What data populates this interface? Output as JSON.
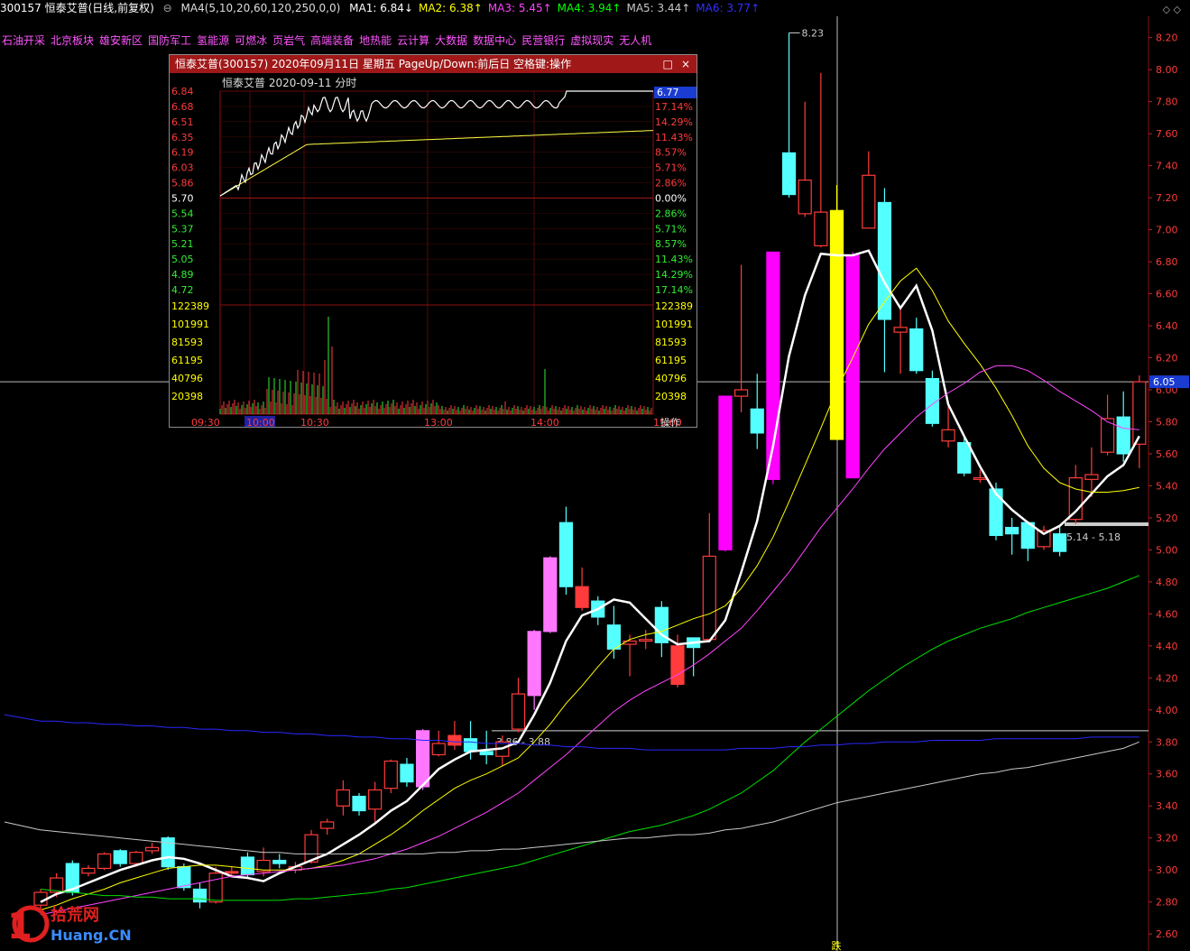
{
  "header": {
    "stock": "300157 恒泰艾普(日线,前复权)",
    "ma_label": "MA4(5,10,20,60,120,250,0,0)",
    "ma": [
      {
        "text": "MA1: 6.84↓",
        "color": "#ffffff"
      },
      {
        "text": "MA2: 6.38↑",
        "color": "#ffff00"
      },
      {
        "text": "MA3: 5.45↑",
        "color": "#ff44ff"
      },
      {
        "text": "MA4: 3.94↑",
        "color": "#00ff00"
      },
      {
        "text": "MA5: 3.44↑",
        "color": "#c8c8c8"
      },
      {
        "text": "MA6: 3.77↑",
        "color": "#3030ff"
      }
    ],
    "win_ctrl": "◇ ◇"
  },
  "tags": [
    "石油开采",
    "北京板块",
    "雄安新区",
    "国防军工",
    "氢能源",
    "可燃冰",
    "页岩气",
    "高端装备",
    "地热能",
    "云计算",
    "大数据",
    "数据中心",
    "民营银行",
    "虚拟现实",
    "无人机"
  ],
  "popup": {
    "title": "恒泰艾普(300157) 2020年09月11日 星期五 PageUp/Down:前后日 空格键:操作",
    "subtitle": "恒泰艾普   2020-09-11 分时",
    "price_labels": [
      "6.84",
      "6.68",
      "6.51",
      "6.35",
      "6.19",
      "6.03",
      "5.86",
      "5.70",
      "5.54",
      "5.37",
      "5.21",
      "5.05",
      "4.89",
      "4.72"
    ],
    "pct_labels": [
      "17.14%",
      "14.29%",
      "11.43%",
      "8.57%",
      "5.71%",
      "2.86%",
      "0.00%",
      "2.86%",
      "5.71%",
      "8.57%",
      "11.43%",
      "14.29%",
      "17.14%"
    ],
    "vol_labels": [
      "122389",
      "101991",
      "81593",
      "61195",
      "40796",
      "20398"
    ],
    "time_labels": [
      "09:30",
      "10:00",
      "10:30",
      "13:00",
      "14:00",
      "15:00"
    ],
    "current": "6.77",
    "op_label": "操作",
    "close_icon": "×",
    "max_icon": "□"
  },
  "colors": {
    "up": "#ff3b3b",
    "down": "#54ffff",
    "grid": "#8a1010"
  },
  "chart_data": {
    "type": "candlestick",
    "ylim": [
      2.55,
      8.3
    ],
    "y_ticks": [
      "2.60",
      "2.80",
      "3.00",
      "3.20",
      "3.40",
      "3.60",
      "3.80",
      "4.00",
      "4.20",
      "4.40",
      "4.60",
      "4.80",
      "5.00",
      "5.20",
      "5.40",
      "5.60",
      "5.80",
      "6.00",
      "6.20",
      "6.40",
      "6.60",
      "6.80",
      "7.00",
      "7.20",
      "7.40",
      "7.60",
      "7.80",
      "8.00",
      "8.20"
    ],
    "candles": [
      [
        2.78,
        2.86,
        2.75,
        2.88,
        "#ff3b3b"
      ],
      [
        2.86,
        2.95,
        2.83,
        2.98,
        "#ff3b3b"
      ],
      [
        3.04,
        2.86,
        2.84,
        3.06,
        "#54ffff"
      ],
      [
        2.98,
        3.01,
        2.96,
        3.03,
        "#ff3b3b"
      ],
      [
        3.01,
        3.1,
        3.0,
        3.11,
        "#ff3b3b"
      ],
      [
        3.12,
        3.04,
        3.02,
        3.13,
        "#54ffff"
      ],
      [
        3.04,
        3.11,
        3.02,
        3.12,
        "#ff3b3b"
      ],
      [
        3.12,
        3.14,
        3.1,
        3.17,
        "#ff3b3b"
      ],
      [
        3.2,
        3.02,
        3.0,
        3.21,
        "#54ffff"
      ],
      [
        3.02,
        2.89,
        2.87,
        3.04,
        "#54ffff"
      ],
      [
        2.88,
        2.8,
        2.76,
        2.92,
        "#54ffff"
      ],
      [
        2.8,
        2.98,
        2.79,
        3.02,
        "#ff3b3b"
      ],
      [
        2.99,
        2.98,
        2.96,
        3.02,
        "#ff3b3b"
      ],
      [
        3.08,
        2.97,
        2.95,
        3.11,
        "#54ffff"
      ],
      [
        2.99,
        3.06,
        2.96,
        3.14,
        "#ff3b3b"
      ],
      [
        3.06,
        3.04,
        3.01,
        3.1,
        "#54ffff"
      ],
      [
        3.0,
        3.02,
        2.98,
        3.05,
        "#ff3b3b"
      ],
      [
        3.05,
        3.22,
        3.04,
        3.25,
        "#ff3b3b"
      ],
      [
        3.26,
        3.3,
        3.22,
        3.32,
        "#ff3b3b"
      ],
      [
        3.4,
        3.5,
        3.34,
        3.56,
        "#ff3b3b"
      ],
      [
        3.46,
        3.37,
        3.34,
        3.48,
        "#54ffff"
      ],
      [
        3.38,
        3.5,
        3.3,
        3.55,
        "#ff3b3b"
      ],
      [
        3.51,
        3.68,
        3.48,
        3.69,
        "#ff3b3b"
      ],
      [
        3.66,
        3.55,
        3.52,
        3.7,
        "#54ffff"
      ],
      [
        3.52,
        3.87,
        3.5,
        3.88,
        "#ff77ff"
      ],
      [
        3.72,
        3.79,
        3.71,
        3.87,
        "#ff3b3b"
      ],
      [
        3.84,
        3.78,
        3.75,
        3.93,
        "#ff3b3b"
      ],
      [
        3.82,
        3.74,
        3.69,
        3.93,
        "#54ffff"
      ],
      [
        3.74,
        3.72,
        3.66,
        3.87,
        "#54ffff"
      ],
      [
        3.71,
        3.8,
        3.65,
        3.84,
        "#ff3b3b"
      ],
      [
        3.88,
        4.1,
        3.86,
        4.2,
        "#ff3b3b"
      ],
      [
        4.09,
        4.49,
        4.0,
        4.5,
        "#ff77ff"
      ],
      [
        4.49,
        4.95,
        4.48,
        4.96,
        "#ff77ff"
      ],
      [
        5.17,
        4.77,
        4.72,
        5.27,
        "#54ffff"
      ],
      [
        4.77,
        4.64,
        4.62,
        4.89,
        "#ff3b3b"
      ],
      [
        4.68,
        4.58,
        4.53,
        4.71,
        "#54ffff"
      ],
      [
        4.53,
        4.38,
        4.32,
        4.65,
        "#54ffff"
      ],
      [
        4.41,
        4.43,
        4.21,
        4.47,
        "#ff3b3b"
      ],
      [
        4.43,
        4.44,
        4.38,
        4.5,
        "#ff3b3b"
      ],
      [
        4.64,
        4.42,
        4.33,
        4.68,
        "#54ffff"
      ],
      [
        4.4,
        4.16,
        4.14,
        4.47,
        "#ff3b3b"
      ],
      [
        4.45,
        4.39,
        4.21,
        4.44,
        "#54ffff"
      ],
      [
        4.44,
        4.96,
        4.43,
        5.23,
        "#ff3b3b"
      ],
      [
        5.0,
        5.96,
        4.99,
        5.96,
        "#ff00ff"
      ],
      [
        5.96,
        6.0,
        5.86,
        6.78,
        "#ff3b3b"
      ],
      [
        5.88,
        5.73,
        5.63,
        6.1,
        "#54ffff"
      ],
      [
        5.44,
        6.86,
        5.41,
        6.86,
        "#ff00ff"
      ],
      [
        7.48,
        7.22,
        7.2,
        8.23,
        "#54ffff"
      ],
      [
        7.1,
        7.31,
        7.08,
        7.8,
        "#ff3b3b"
      ],
      [
        6.9,
        7.11,
        6.89,
        7.98,
        "#ff3b3b"
      ],
      [
        7.12,
        5.69,
        5.7,
        7.28,
        "#ffff00"
      ],
      [
        6.84,
        5.45,
        5.47,
        6.86,
        "#ff00ff"
      ],
      [
        7.01,
        7.34,
        7.01,
        7.49,
        "#ff3b3b"
      ],
      [
        7.17,
        6.44,
        6.11,
        7.26,
        "#54ffff"
      ],
      [
        6.36,
        6.39,
        6.1,
        6.52,
        "#ff3b3b"
      ],
      [
        6.38,
        6.12,
        6.1,
        6.45,
        "#54ffff"
      ],
      [
        6.07,
        5.79,
        5.77,
        6.12,
        "#54ffff"
      ],
      [
        5.68,
        5.75,
        5.64,
        5.92,
        "#ff3b3b"
      ],
      [
        5.67,
        5.48,
        5.46,
        5.71,
        "#54ffff"
      ],
      [
        5.44,
        5.45,
        5.42,
        5.5,
        "#ff3b3b"
      ],
      [
        5.38,
        5.09,
        5.06,
        5.42,
        "#54ffff"
      ],
      [
        5.14,
        5.1,
        4.97,
        5.2,
        "#54ffff"
      ],
      [
        5.17,
        5.01,
        4.93,
        5.18,
        "#54ffff"
      ],
      [
        5.02,
        5.12,
        5.0,
        5.15,
        "#ff3b3b"
      ],
      [
        5.1,
        4.99,
        4.96,
        5.15,
        "#54ffff"
      ],
      [
        5.19,
        5.45,
        5.16,
        5.53,
        "#ff3b3b"
      ],
      [
        5.44,
        5.47,
        5.33,
        5.64,
        "#ff3b3b"
      ],
      [
        5.61,
        5.82,
        5.59,
        5.97,
        "#ff3b3b"
      ],
      [
        5.83,
        5.6,
        5.55,
        5.99,
        "#54ffff"
      ],
      [
        5.66,
        6.05,
        5.51,
        6.09,
        "#ff3b3b"
      ]
    ],
    "ma_lines": [
      {
        "name": "MA1",
        "color": "#ffffff",
        "width": 2.5,
        "values": [
          2.8,
          2.85,
          2.88,
          2.92,
          2.96,
          3.0,
          3.03,
          3.06,
          3.08,
          3.07,
          3.04,
          3.0,
          2.96,
          2.95,
          2.93,
          2.98,
          3.02,
          3.06,
          3.1,
          3.16,
          3.22,
          3.29,
          3.37,
          3.43,
          3.53,
          3.63,
          3.69,
          3.74,
          3.75,
          3.76,
          3.8,
          3.97,
          4.17,
          4.43,
          4.59,
          4.63,
          4.69,
          4.67,
          4.57,
          4.47,
          4.41,
          4.42,
          4.43,
          4.56,
          4.86,
          5.18,
          5.65,
          6.21,
          6.59,
          6.85,
          6.84,
          6.84,
          6.87,
          6.67,
          6.51,
          6.65,
          6.37,
          5.91,
          5.71,
          5.52,
          5.35,
          5.25,
          5.17,
          5.1,
          5.15,
          5.24,
          5.35,
          5.46,
          5.53,
          5.71
        ]
      },
      {
        "name": "MA2",
        "color": "#ffff00",
        "width": 1,
        "values": [
          2.75,
          2.78,
          2.82,
          2.85,
          2.88,
          2.92,
          2.95,
          2.98,
          3.01,
          3.02,
          3.03,
          3.03,
          3.02,
          3.01,
          3.0,
          3.0,
          3.0,
          3.01,
          3.03,
          3.06,
          3.1,
          3.16,
          3.22,
          3.29,
          3.37,
          3.44,
          3.51,
          3.56,
          3.6,
          3.65,
          3.7,
          3.8,
          3.91,
          4.04,
          4.15,
          4.27,
          4.38,
          4.44,
          4.47,
          4.49,
          4.53,
          4.57,
          4.6,
          4.65,
          4.76,
          4.9,
          5.08,
          5.3,
          5.53,
          5.76,
          6.0,
          6.2,
          6.41,
          6.55,
          6.68,
          6.76,
          6.62,
          6.43,
          6.29,
          6.16,
          6.01,
          5.84,
          5.65,
          5.51,
          5.42,
          5.38,
          5.36,
          5.36,
          5.37,
          5.39
        ]
      },
      {
        "name": "MA3",
        "color": "#ff44ff",
        "width": 1,
        "values": [
          2.72,
          2.74,
          2.76,
          2.78,
          2.8,
          2.82,
          2.84,
          2.86,
          2.88,
          2.9,
          2.92,
          2.94,
          2.96,
          2.97,
          2.98,
          2.99,
          3.0,
          3.01,
          3.02,
          3.03,
          3.05,
          3.07,
          3.1,
          3.13,
          3.17,
          3.21,
          3.26,
          3.31,
          3.36,
          3.42,
          3.48,
          3.56,
          3.64,
          3.72,
          3.81,
          3.9,
          3.99,
          4.06,
          4.12,
          4.17,
          4.22,
          4.28,
          4.35,
          4.43,
          4.51,
          4.62,
          4.74,
          4.86,
          5.0,
          5.14,
          5.26,
          5.38,
          5.51,
          5.63,
          5.73,
          5.83,
          5.91,
          5.98,
          6.04,
          6.11,
          6.15,
          6.15,
          6.12,
          6.06,
          5.99,
          5.93,
          5.87,
          5.8,
          5.76,
          5.75
        ]
      },
      {
        "name": "MA4",
        "color": "#00e000",
        "width": 1,
        "values": [
          2.88,
          2.87,
          2.86,
          2.85,
          2.84,
          2.84,
          2.83,
          2.83,
          2.82,
          2.82,
          2.82,
          2.81,
          2.81,
          2.81,
          2.81,
          2.81,
          2.82,
          2.82,
          2.83,
          2.84,
          2.85,
          2.86,
          2.88,
          2.89,
          2.91,
          2.93,
          2.95,
          2.97,
          2.99,
          3.01,
          3.03,
          3.06,
          3.09,
          3.12,
          3.15,
          3.18,
          3.21,
          3.24,
          3.26,
          3.28,
          3.31,
          3.34,
          3.38,
          3.43,
          3.48,
          3.55,
          3.62,
          3.71,
          3.8,
          3.88,
          3.96,
          4.04,
          4.12,
          4.19,
          4.26,
          4.32,
          4.38,
          4.43,
          4.47,
          4.51,
          4.54,
          4.57,
          4.61,
          4.64,
          4.67,
          4.7,
          4.73,
          4.76,
          4.8,
          4.84
        ]
      },
      {
        "name": "MA5",
        "color": "#c8c8c8",
        "width": 1,
        "values": [
          3.25,
          3.24,
          3.23,
          3.22,
          3.21,
          3.2,
          3.19,
          3.18,
          3.17,
          3.16,
          3.15,
          3.14,
          3.13,
          3.12,
          3.11,
          3.11,
          3.1,
          3.1,
          3.1,
          3.1,
          3.1,
          3.1,
          3.1,
          3.1,
          3.1,
          3.11,
          3.11,
          3.12,
          3.12,
          3.13,
          3.13,
          3.14,
          3.15,
          3.16,
          3.17,
          3.18,
          3.19,
          3.2,
          3.2,
          3.21,
          3.22,
          3.22,
          3.23,
          3.25,
          3.26,
          3.28,
          3.3,
          3.33,
          3.36,
          3.39,
          3.42,
          3.44,
          3.46,
          3.48,
          3.5,
          3.52,
          3.54,
          3.56,
          3.58,
          3.6,
          3.61,
          3.63,
          3.64,
          3.66,
          3.68,
          3.7,
          3.72,
          3.74,
          3.76,
          3.8
        ]
      },
      {
        "name": "MA6",
        "color": "#2828ff",
        "width": 1,
        "values": [
          3.93,
          3.93,
          3.92,
          3.92,
          3.91,
          3.91,
          3.9,
          3.9,
          3.89,
          3.89,
          3.88,
          3.88,
          3.87,
          3.87,
          3.86,
          3.86,
          3.85,
          3.85,
          3.84,
          3.84,
          3.83,
          3.83,
          3.82,
          3.82,
          3.81,
          3.81,
          3.8,
          3.8,
          3.79,
          3.79,
          3.79,
          3.78,
          3.78,
          3.77,
          3.77,
          3.76,
          3.76,
          3.76,
          3.75,
          3.75,
          3.75,
          3.75,
          3.75,
          3.75,
          3.76,
          3.76,
          3.76,
          3.77,
          3.77,
          3.78,
          3.78,
          3.79,
          3.79,
          3.8,
          3.8,
          3.8,
          3.81,
          3.81,
          3.81,
          3.81,
          3.82,
          3.82,
          3.82,
          3.82,
          3.82,
          3.82,
          3.83,
          3.83,
          3.83,
          3.83
        ]
      }
    ],
    "high_label": "8.23",
    "range_labels": [
      "3.86 - 3.88",
      "5.14 - 5.18"
    ],
    "current_price": "6.05",
    "bottom_mark": "跌",
    "watermark": "10 拾荒网 Huang.CN"
  }
}
